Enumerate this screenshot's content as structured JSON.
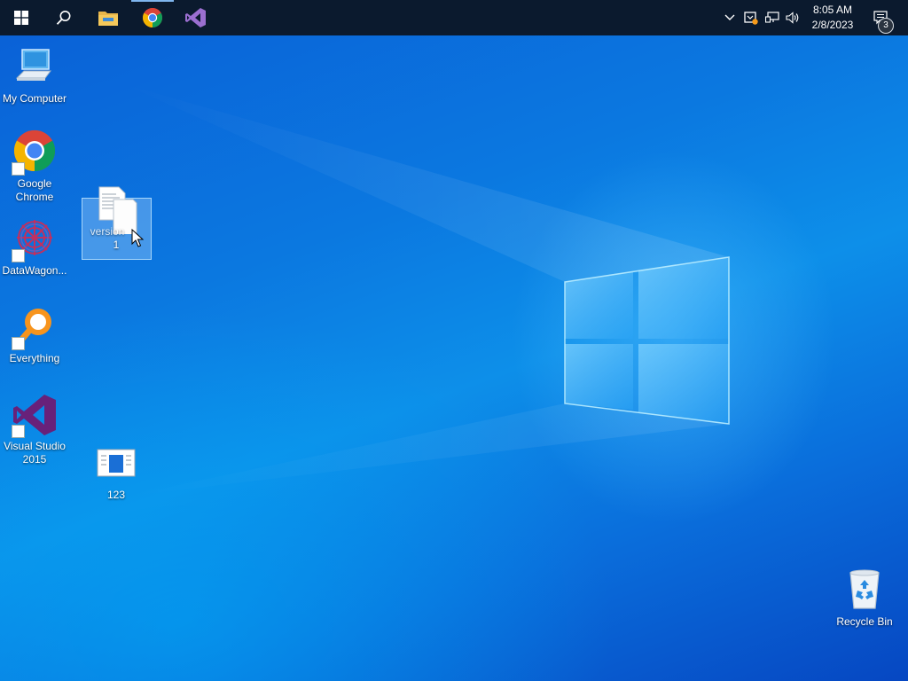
{
  "taskbar": {
    "pinned": [
      {
        "name": "start-button",
        "icon": "windows-logo-icon"
      },
      {
        "name": "search-button",
        "icon": "search-icon"
      },
      {
        "name": "file-explorer-button",
        "icon": "folder-icon"
      },
      {
        "name": "chrome-button",
        "icon": "chrome-icon"
      },
      {
        "name": "visual-studio-button",
        "icon": "visual-studio-icon"
      }
    ],
    "tray": {
      "time": "8:05 AM",
      "date": "2/8/2023",
      "notification_count": "3"
    }
  },
  "desktop": {
    "icons": [
      {
        "label": "My Computer",
        "icon": "computer-icon"
      },
      {
        "label": "Google Chrome",
        "icon": "chrome-icon"
      },
      {
        "label": "DataWagon...",
        "icon": "datawagon-icon"
      },
      {
        "label": "Everything",
        "icon": "everything-search-icon"
      },
      {
        "label": "Visual Studio 2015",
        "icon": "visual-studio-icon"
      },
      {
        "label": "Recycle Bin",
        "icon": "recycle-bin-icon"
      }
    ],
    "files": [
      {
        "label_top": "version",
        "label_bottom": "1",
        "icon": "document-icon",
        "selected": true
      },
      {
        "label": "123",
        "icon": "image-file-icon"
      }
    ]
  },
  "colors": {
    "taskbar": "#0b1a2e",
    "wallpaper_blue": "#0a78e0",
    "selection": "#b4dcff"
  }
}
